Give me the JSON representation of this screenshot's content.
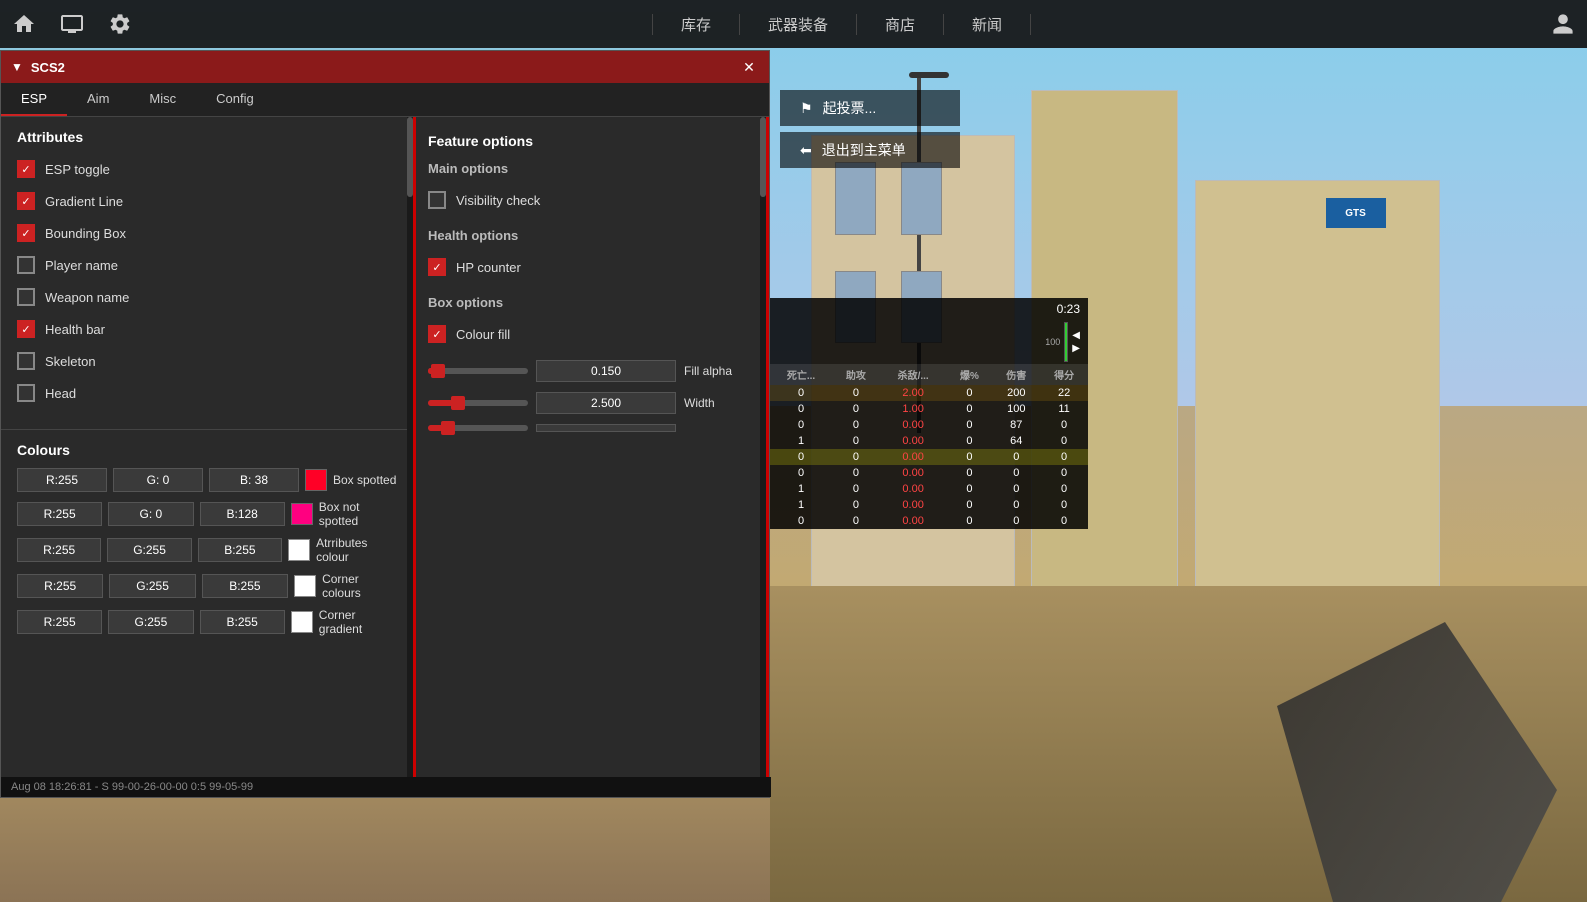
{
  "topnav": {
    "items": [
      "库存",
      "武器装备",
      "商店",
      "新闻"
    ]
  },
  "panel": {
    "title": "SCS2",
    "close_label": "✕",
    "tabs": [
      "ESP",
      "Aim",
      "Misc",
      "Config"
    ],
    "active_tab": "ESP"
  },
  "attributes": {
    "header": "Attributes",
    "items": [
      {
        "label": "ESP toggle",
        "checked": true
      },
      {
        "label": "Gradient Line",
        "checked": true
      },
      {
        "label": "Bounding Box",
        "checked": true
      },
      {
        "label": "Player name",
        "checked": false
      },
      {
        "label": "Weapon name",
        "checked": false
      },
      {
        "label": "Health bar",
        "checked": true
      },
      {
        "label": "Skeleton",
        "checked": false
      },
      {
        "label": "Head",
        "checked": false
      }
    ]
  },
  "feature_options": {
    "header": "Feature options",
    "main_options_header": "Main options",
    "visibility_check": {
      "label": "Visibility check",
      "checked": false
    },
    "health_options_header": "Health options",
    "hp_counter": {
      "label": "HP counter",
      "checked": true
    },
    "box_options_header": "Box options",
    "colour_fill": {
      "label": "Colour fill",
      "checked": true
    },
    "fill_alpha": {
      "label": "Fill alpha",
      "value": "0.150",
      "percent": 5
    },
    "width": {
      "label": "Width",
      "value": "2.500",
      "percent": 25
    }
  },
  "colours": {
    "header": "Colours",
    "rows": [
      {
        "r": "R:255",
        "g": "G:  0",
        "b": "B: 38",
        "color": "#ff0026",
        "name": "Box spotted"
      },
      {
        "r": "R:255",
        "g": "G:  0",
        "b": "B:128",
        "color": "#ff0080",
        "name": "Box not spotted"
      },
      {
        "r": "R:255",
        "g": "G:255",
        "b": "B:255",
        "color": "#ffffff",
        "name": "Atrributes colour"
      },
      {
        "r": "R:255",
        "g": "G:255",
        "b": "B:255",
        "color": "#ffffff",
        "name": "Corner colours"
      },
      {
        "r": "R:255",
        "g": "G:255",
        "b": "B:255",
        "color": "#ffffff",
        "name": "Corner gradient"
      }
    ]
  },
  "scoreboard": {
    "timer": "0:23",
    "cols": [
      "死亡...",
      "助攻",
      "杀敌/...",
      "爆%",
      "伤害",
      "得分"
    ],
    "rows": [
      {
        "team": "t",
        "deaths": "0",
        "assists": "0",
        "kills": "2.00",
        "pct": "0",
        "dmg": "200",
        "score": "22",
        "kill_color": "red"
      },
      {
        "team": "t",
        "deaths": "0",
        "assists": "0",
        "kills": "1.00",
        "pct": "0",
        "dmg": "100",
        "score": "11",
        "kill_color": "red"
      },
      {
        "team": "t",
        "deaths": "0",
        "assists": "0",
        "kills": "0.00",
        "pct": "0",
        "dmg": "87",
        "score": "0"
      },
      {
        "team": "t",
        "deaths": "1",
        "assists": "0",
        "kills": "0.00",
        "pct": "0",
        "dmg": "64",
        "score": "0"
      },
      {
        "team": "ct",
        "deaths": "0",
        "assists": "0",
        "kills": "0.00",
        "pct": "0",
        "dmg": "0",
        "score": "0"
      },
      {
        "team": "ct",
        "deaths": "0",
        "assists": "0",
        "kills": "0.00",
        "pct": "0",
        "dmg": "0",
        "score": "0"
      },
      {
        "team": "ct",
        "deaths": "1",
        "assists": "0",
        "kills": "0.00",
        "pct": "0",
        "dmg": "0",
        "score": "0"
      },
      {
        "team": "ct",
        "deaths": "1",
        "assists": "0",
        "kills": "0.00",
        "pct": "0",
        "dmg": "0",
        "score": "0"
      },
      {
        "team": "ct",
        "deaths": "0",
        "assists": "0",
        "kills": "0.00",
        "pct": "0",
        "dmg": "0",
        "score": "0"
      }
    ]
  },
  "game_menu": {
    "vote_label": "起投票...",
    "exit_label": "退出到主菜单"
  },
  "status_bar": {
    "text": "Aug 08 18:26:81 - S 99-00-26-00-00 0:5 99-05-99"
  }
}
